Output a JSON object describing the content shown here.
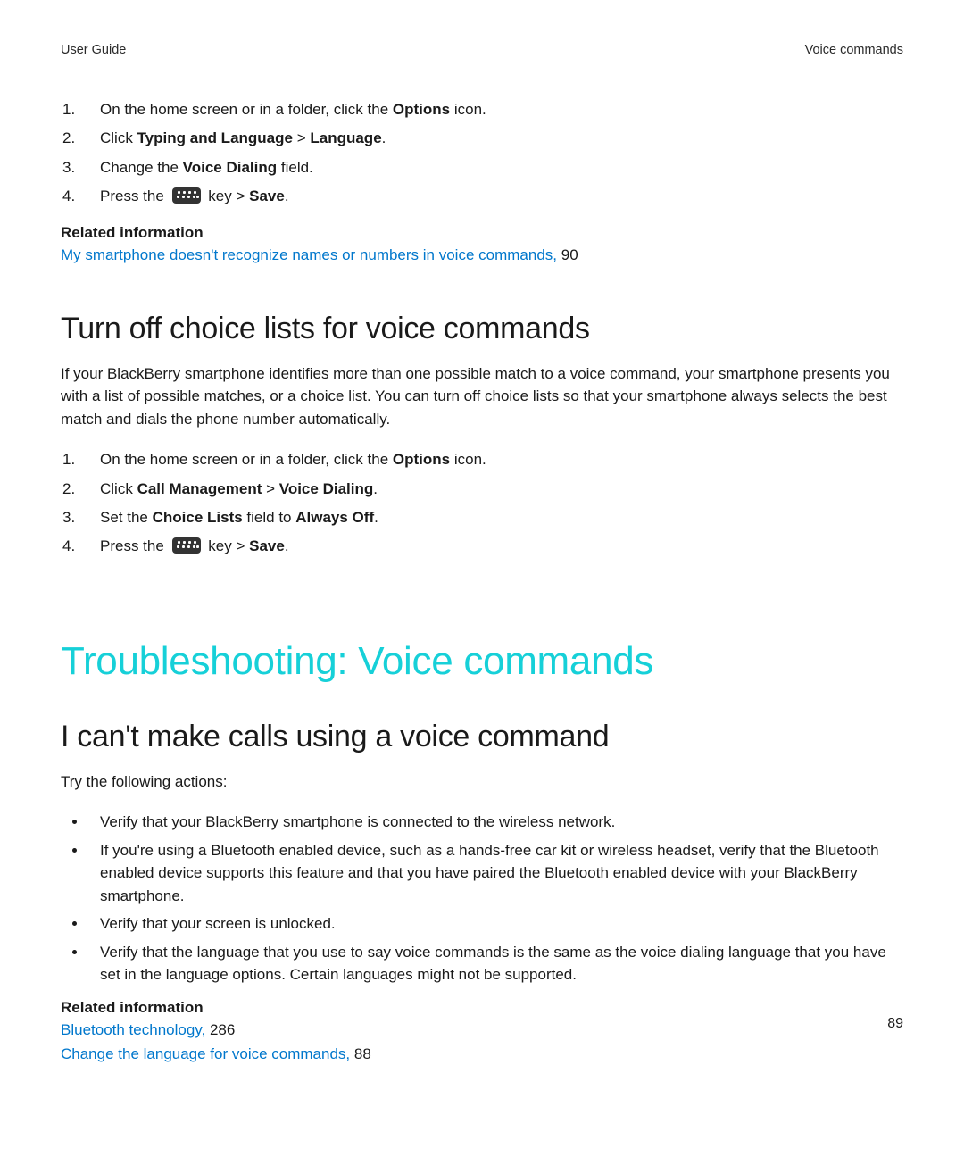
{
  "header": {
    "left": "User Guide",
    "right": "Voice commands"
  },
  "intro_steps": [
    {
      "pre": "On the home screen or in a folder, click the ",
      "b1": "Options",
      "post": " icon."
    },
    {
      "pre": "Click ",
      "b1": "Typing and Language",
      "mid": " > ",
      "b2": "Language",
      "post": "."
    },
    {
      "pre": "Change the ",
      "b1": "Voice Dialing",
      "post": " field."
    },
    {
      "pre": "Press the ",
      "icon": true,
      "mid": " key > ",
      "b1": "Save",
      "post": "."
    }
  ],
  "related1": {
    "heading": "Related information",
    "link": "My smartphone doesn't recognize names or numbers in voice commands,",
    "page": " 90"
  },
  "section1": {
    "title": "Turn off choice lists for voice commands",
    "body": "If your BlackBerry smartphone identifies more than one possible match to a voice command, your smartphone presents you with a list of possible matches, or a choice list. You can turn off choice lists so that your smartphone always selects the best match and dials the phone number automatically.",
    "steps": [
      {
        "pre": "On the home screen or in a folder, click the ",
        "b1": "Options",
        "post": " icon."
      },
      {
        "pre": "Click ",
        "b1": "Call Management",
        "mid": " > ",
        "b2": "Voice Dialing",
        "post": "."
      },
      {
        "pre": "Set the ",
        "b1": "Choice Lists",
        "mid": " field to ",
        "b2": "Always Off",
        "post": "."
      },
      {
        "pre": "Press the ",
        "icon": true,
        "mid": " key > ",
        "b1": "Save",
        "post": "."
      }
    ]
  },
  "chapter": {
    "title": "Troubleshooting: Voice commands"
  },
  "section2": {
    "title": "I can't make calls using a voice command",
    "lead": "Try the following actions:",
    "bullets": [
      "Verify that your BlackBerry smartphone is connected to the wireless network.",
      "If you're using a Bluetooth enabled device, such as a hands-free car kit or wireless headset, verify that the Bluetooth enabled device supports this feature and that you have paired the Bluetooth enabled device with your BlackBerry smartphone.",
      "Verify that your screen is unlocked.",
      "Verify that the language that you use to say voice commands is the same as the voice dialing language that you have set in the language options. Certain languages might not be supported."
    ]
  },
  "related2": {
    "heading": "Related information",
    "links": [
      {
        "text": "Bluetooth technology,",
        "page": " 286"
      },
      {
        "text": "Change the language for voice commands,",
        "page": " 88"
      }
    ]
  },
  "page_number": "89"
}
